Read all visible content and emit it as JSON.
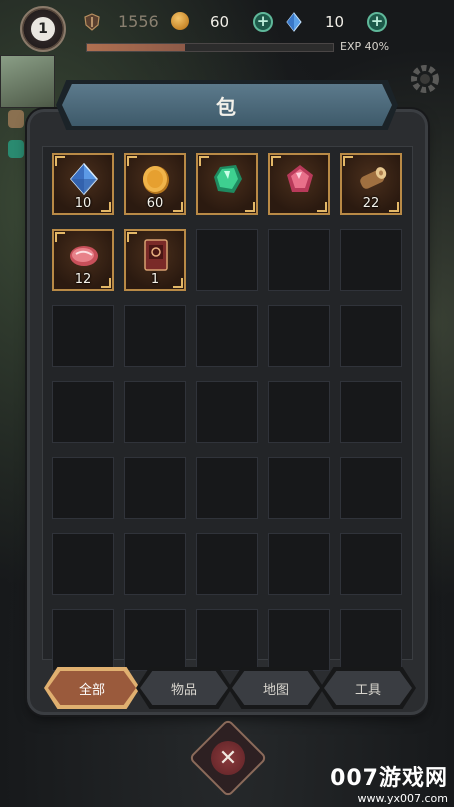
{
  "hud": {
    "level": "1",
    "power": "1556",
    "coins": "60",
    "gems": "10",
    "exp_label": "EXP 40%",
    "exp_fraction": 0.4
  },
  "panel": {
    "title": "包"
  },
  "inventory": {
    "items": [
      {
        "icon": "blue-crystal-icon",
        "qty": "10"
      },
      {
        "icon": "gold-coin-icon",
        "qty": "60"
      },
      {
        "icon": "green-gem-icon",
        "qty": ""
      },
      {
        "icon": "red-gem-icon",
        "qty": ""
      },
      {
        "icon": "wood-log-icon",
        "qty": "22"
      },
      {
        "icon": "raw-meat-icon",
        "qty": "12"
      },
      {
        "icon": "card-icon",
        "qty": "1"
      }
    ],
    "total_slots": 35
  },
  "tabs": [
    {
      "label": "全部",
      "active": true
    },
    {
      "label": "物品",
      "active": false
    },
    {
      "label": "地图",
      "active": false
    },
    {
      "label": "工具",
      "active": false
    }
  ],
  "watermark": {
    "line1": "007游戏网",
    "line2": "www.yx007.com"
  },
  "colors": {
    "accent": "#b98a46",
    "tab_active": "#9a5a3c",
    "banner": "#4e6c7c"
  }
}
